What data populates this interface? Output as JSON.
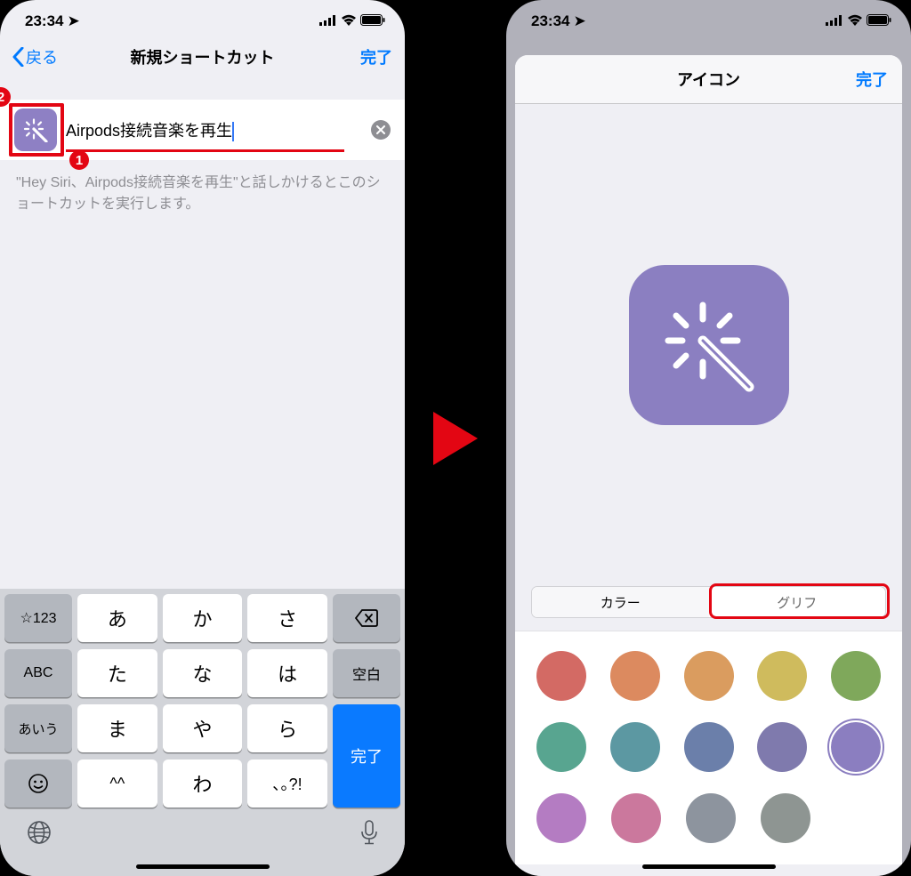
{
  "status": {
    "time": "23:34"
  },
  "left": {
    "back": "戻る",
    "title": "新規ショートカット",
    "done": "完了",
    "shortcut_name": "Airpods接続音楽を再生",
    "hint": "\"Hey Siri、Airpods接続音楽を再生\"と話しかけるとこのショートカットを実行します。",
    "annot1": "1",
    "annot2": "2",
    "keyboard": {
      "r1": [
        "☆123",
        "あ",
        "か",
        "さ"
      ],
      "r2": [
        "ABC",
        "た",
        "な",
        "は",
        "空白"
      ],
      "r3": [
        "あいう",
        "ま",
        "や",
        "ら"
      ],
      "r4": [
        "^^",
        "わ",
        "､｡?!"
      ],
      "action": "完了"
    }
  },
  "right": {
    "title": "アイコン",
    "done": "完了",
    "seg_color": "カラー",
    "seg_glyph": "グリフ",
    "colors_r1": [
      "#d36a64",
      "#dc8a5f",
      "#da9c5f",
      "#cfbb5d",
      "#7fa85b"
    ],
    "colors_r2": [
      "#58a590",
      "#5c98a2",
      "#6b7faa",
      "#7f7aad",
      "#8b7ec0"
    ],
    "colors_r3": [
      "#b47cc2",
      "#cb789d",
      "#8d949e",
      "#8e9592"
    ],
    "selected_color": "#8b7ec0"
  }
}
